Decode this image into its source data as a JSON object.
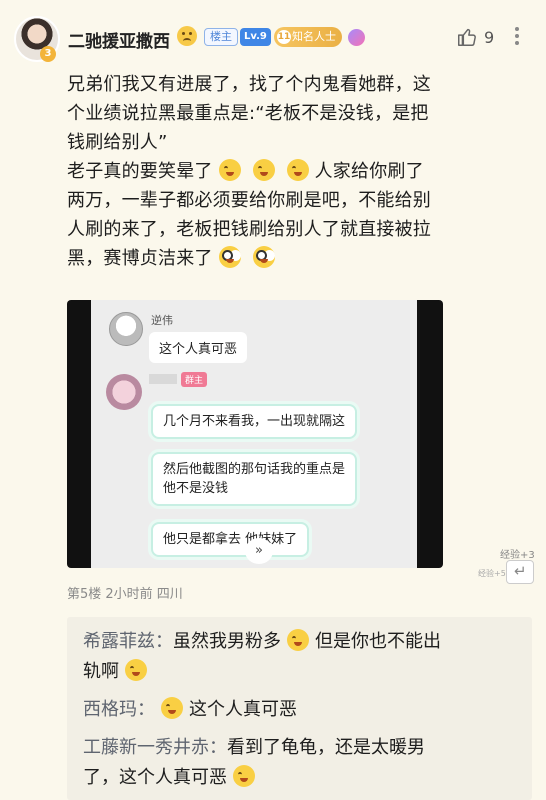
{
  "header": {
    "username": "二驰援亚撒西",
    "avatar_badge": "3",
    "tag_louzhu": "楼主",
    "tag_level": "Lv.9",
    "tag_famous_num": "11",
    "tag_famous": "知名人士",
    "like_count": "9"
  },
  "post": {
    "lines": [
      "兄弟们我又有进展了，找了个内鬼看她群，这",
      "个业绩说拉黑最重点是:“老板不是没钱，是把",
      "钱刷给别人”",
      "老子真的要笑晕了",
      "人家给你刷了",
      "两万，一辈子都必须要给你刷是吧，不能给别",
      "人刷的来了，老板把钱刷给别人了就直接被拉",
      "黑，赛博贞洁来了"
    ]
  },
  "screenshot": {
    "name1": "逆伟",
    "msg1": "这个人真可恶",
    "admin_tag": "群主",
    "msg2": "几个月不来看我，一出现就隔这",
    "msg3a": "然后他截图的那句话我的重点是",
    "msg3b": "他不是没钱",
    "msg4": "他只是都拿去  他妹妹了",
    "chevron": "»"
  },
  "exp": "经验+3",
  "exp2": "经验+5",
  "floor_meta": "第5楼 2小时前 四川",
  "replies": [
    {
      "who": "希露菲兹：",
      "text1": "虽然我男粉多",
      "text2": "但是你也不能出",
      "text3": "轨啊"
    },
    {
      "who": "西格玛：",
      "text": "这个人真可恶"
    },
    {
      "who": "工藤新一秀井赤：",
      "text1": "看到了龟龟，还是太暖男",
      "text2": "了，这个人真可恶"
    }
  ]
}
